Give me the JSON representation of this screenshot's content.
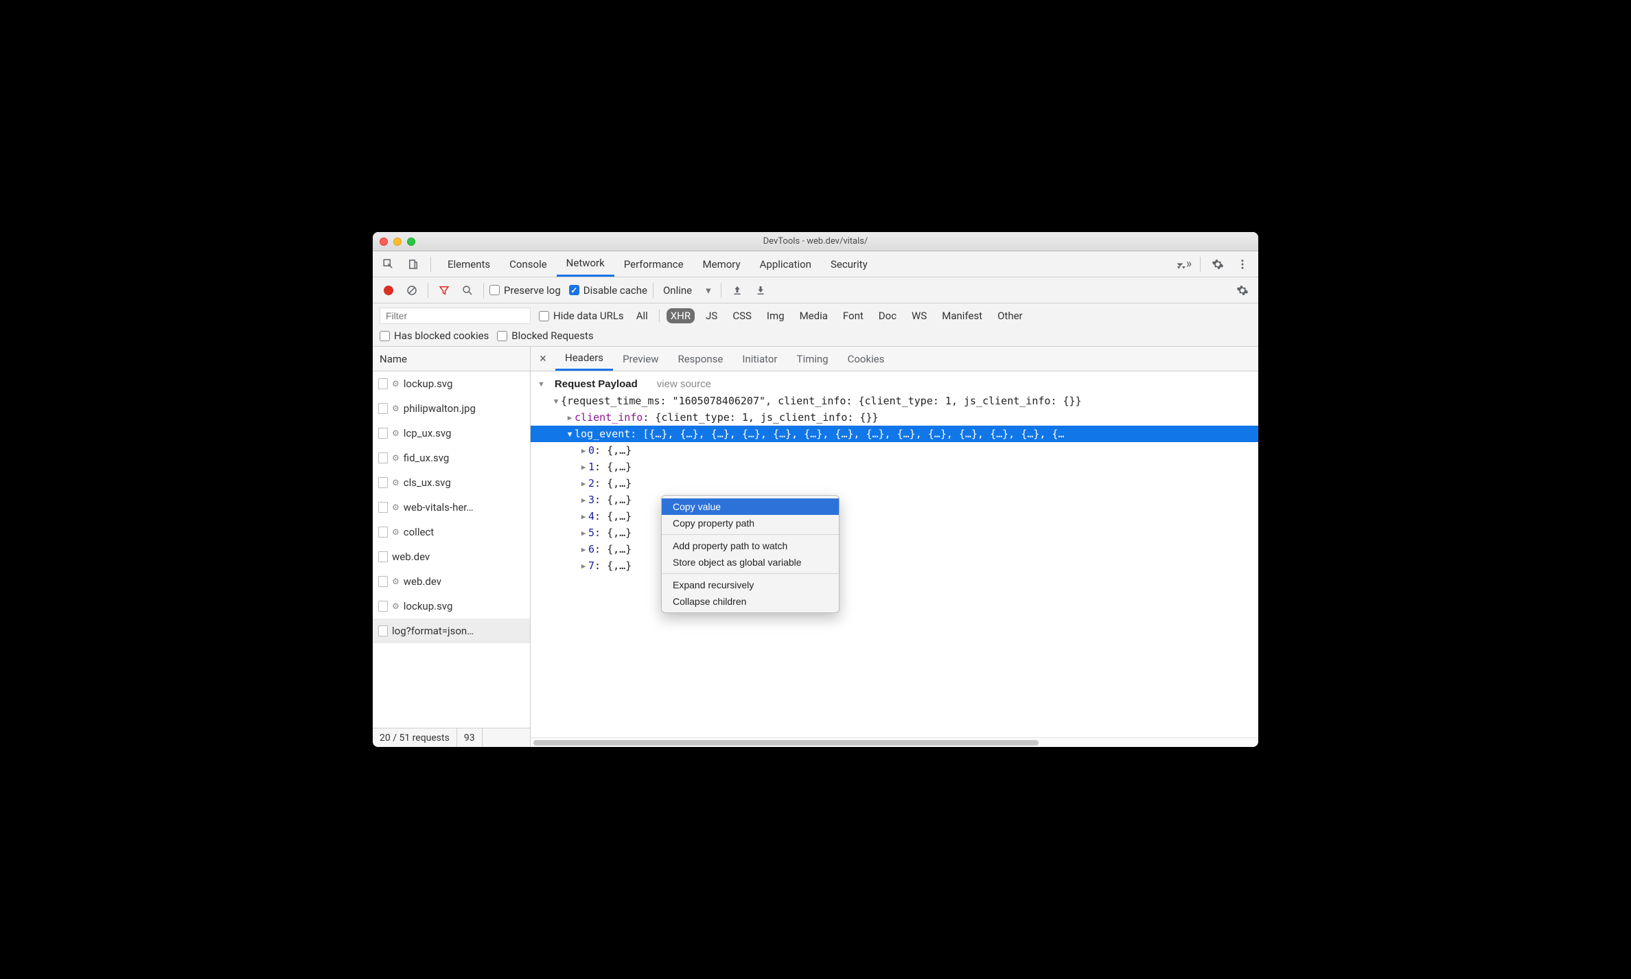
{
  "window_title": "DevTools - web.dev/vitals/",
  "panel_tabs": [
    "Elements",
    "Console",
    "Network",
    "Performance",
    "Memory",
    "Application",
    "Security"
  ],
  "panel_active_index": 2,
  "toolbar": {
    "preserve_log_label": "Preserve log",
    "preserve_log_checked": false,
    "disable_cache_label": "Disable cache",
    "disable_cache_checked": true,
    "throttling_value": "Online"
  },
  "filter": {
    "placeholder": "Filter",
    "hide_data_urls_label": "Hide data URLs",
    "types": [
      "All",
      "XHR",
      "JS",
      "CSS",
      "Img",
      "Media",
      "Font",
      "Doc",
      "WS",
      "Manifest",
      "Other"
    ],
    "type_active_index": 1,
    "has_blocked_cookies_label": "Has blocked cookies",
    "blocked_requests_label": "Blocked Requests"
  },
  "left": {
    "header_label": "Name",
    "files": [
      {
        "name": "lockup.svg",
        "gear": true
      },
      {
        "name": "philipwalton.jpg",
        "gear": true
      },
      {
        "name": "lcp_ux.svg",
        "gear": true
      },
      {
        "name": "fid_ux.svg",
        "gear": true
      },
      {
        "name": "cls_ux.svg",
        "gear": true
      },
      {
        "name": "web-vitals-her…",
        "gear": true
      },
      {
        "name": "collect",
        "gear": true
      },
      {
        "name": "web.dev",
        "gear": false
      },
      {
        "name": "web.dev",
        "gear": true
      },
      {
        "name": "lockup.svg",
        "gear": true
      },
      {
        "name": "log?format=json…",
        "gear": false,
        "selected": true
      }
    ],
    "status_requests": "20 / 51 requests",
    "status_extra": "93"
  },
  "detail": {
    "tabs": [
      "Headers",
      "Preview",
      "Response",
      "Initiator",
      "Timing",
      "Cookies"
    ],
    "tab_active_index": 0,
    "section_title": "Request Payload",
    "view_source_label": "view source",
    "root_line": "{request_time_ms: \"1605078406207\", client_info: {client_type: 1, js_client_info: {}}",
    "client_info_key": "client_info",
    "client_info_val": "{client_type: 1, js_client_info: {}}",
    "log_event_key": "log_event",
    "log_event_preview": "[{…}, {…}, {…}, {…}, {…}, {…}, {…}, {…}, {…}, {…}, {…}, {…}, {…}, {…",
    "log_event_items": [
      "0",
      "1",
      "2",
      "3",
      "4",
      "5",
      "6",
      "7"
    ],
    "item_val": "{,…}"
  },
  "context_menu": {
    "items": [
      "Copy value",
      "Copy property path",
      "-",
      "Add property path to watch",
      "Store object as global variable",
      "-",
      "Expand recursively",
      "Collapse children"
    ],
    "selected_index": 0
  },
  "icons": {
    "more": "more-icon",
    "gear": "gear-icon",
    "inspect": "inspect-icon",
    "device": "device-icon",
    "clear": "clear-icon",
    "filter": "filter-icon",
    "search": "search-icon",
    "upload": "upload-icon",
    "download": "download-icon",
    "dropdown": "dropdown-icon"
  }
}
